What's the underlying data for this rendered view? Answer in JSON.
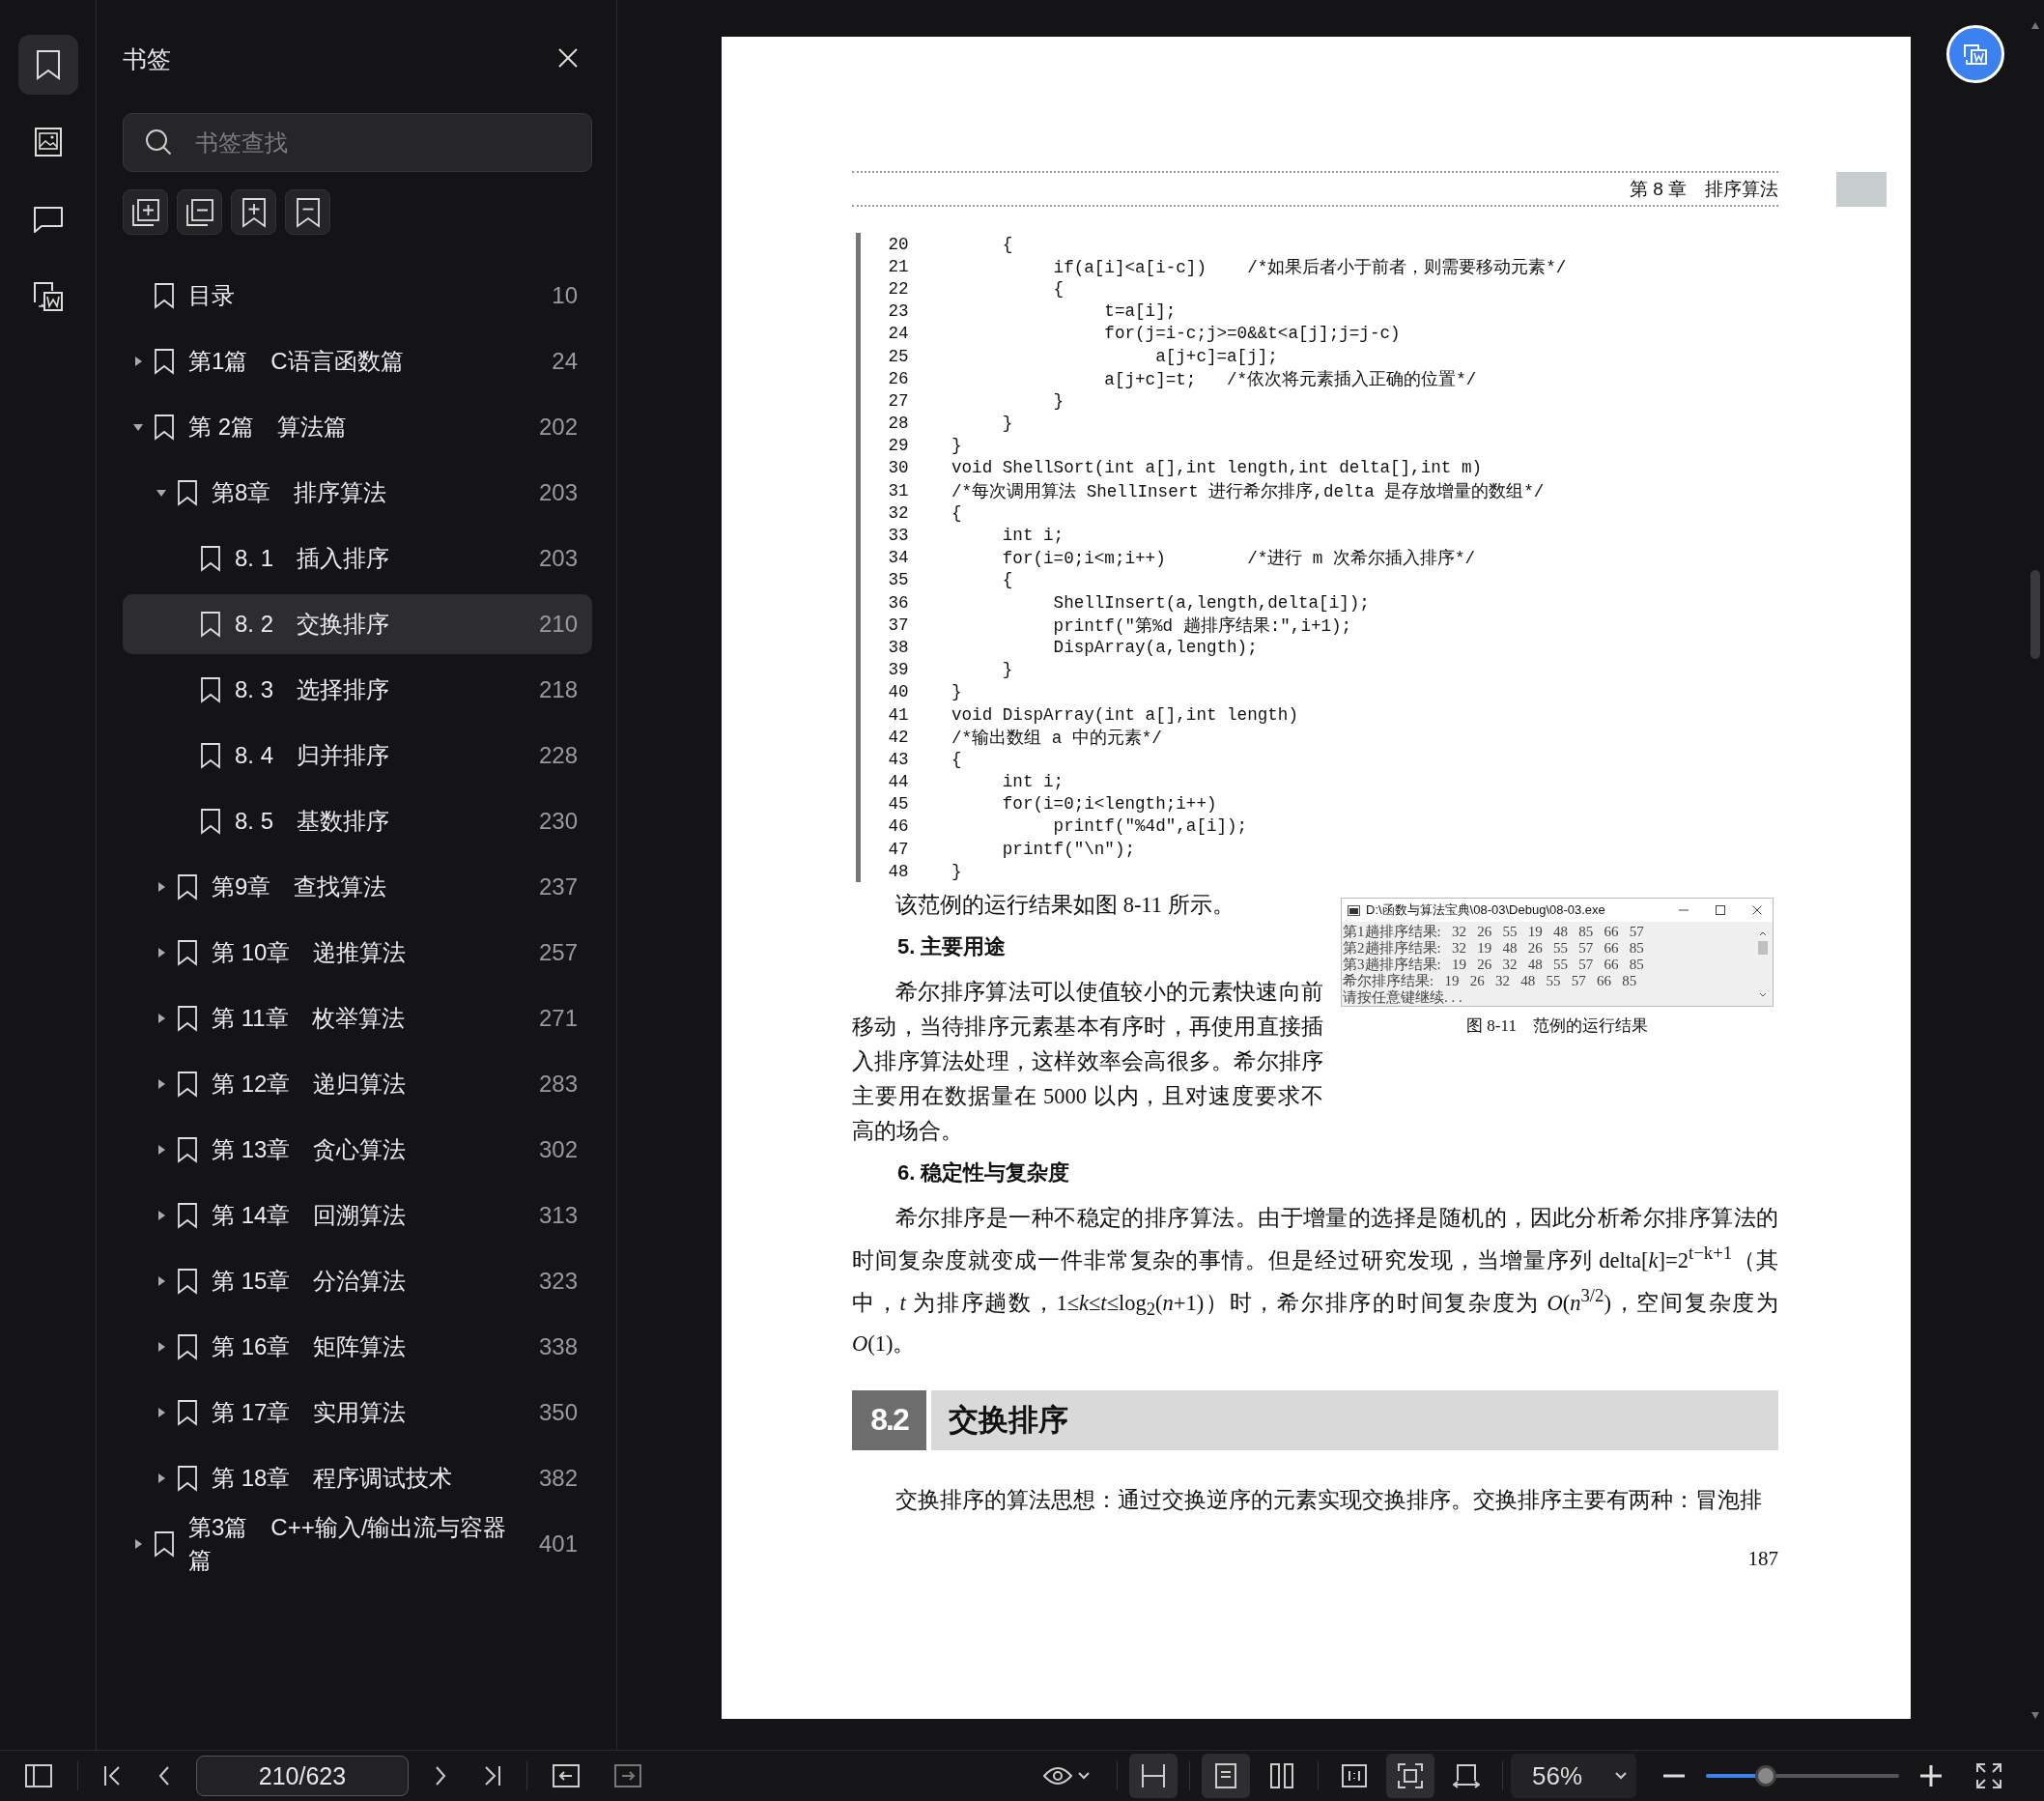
{
  "rail": [
    {
      "kind": "bookmark",
      "selected": true
    },
    {
      "kind": "image",
      "selected": false
    },
    {
      "kind": "comment",
      "selected": false
    },
    {
      "kind": "convert",
      "selected": false
    }
  ],
  "bookmarks": {
    "title": "书签",
    "search": {
      "placeholder": "书签查找"
    },
    "items": [
      {
        "label": "目录",
        "page": "10",
        "selected": false
      },
      {
        "label": "第1篇　C语言函数篇",
        "page": "24",
        "selected": false,
        "expanded": false
      },
      {
        "label": "第 2篇　算法篇",
        "page": "202",
        "selected": false,
        "expanded": true,
        "children": [
          {
            "label": "第8章　排序算法",
            "page": "203",
            "selected": false,
            "expanded": true,
            "children": [
              {
                "label": "8. 1　插入排序",
                "page": "203",
                "selected": false
              },
              {
                "label": "8. 2　交换排序",
                "page": "210",
                "selected": true
              },
              {
                "label": "8. 3　选择排序",
                "page": "218",
                "selected": false
              },
              {
                "label": "8. 4　归并排序",
                "page": "228",
                "selected": false
              },
              {
                "label": "8. 5　基数排序",
                "page": "230",
                "selected": false
              }
            ]
          },
          {
            "label": "第9章　查找算法",
            "page": "237",
            "selected": false,
            "expanded": false
          },
          {
            "label": "第 10章　递推算法",
            "page": "257",
            "selected": false,
            "expanded": false
          },
          {
            "label": "第 11章　枚举算法",
            "page": "271",
            "selected": false,
            "expanded": false
          },
          {
            "label": "第 12章　递归算法",
            "page": "283",
            "selected": false,
            "expanded": false
          },
          {
            "label": "第 13章　贪心算法",
            "page": "302",
            "selected": false,
            "expanded": false
          },
          {
            "label": "第 14章　回溯算法",
            "page": "313",
            "selected": false,
            "expanded": false
          },
          {
            "label": "第 15章　分治算法",
            "page": "323",
            "selected": false,
            "expanded": false
          },
          {
            "label": "第 16章　矩阵算法",
            "page": "338",
            "selected": false,
            "expanded": false
          },
          {
            "label": "第 17章　实用算法",
            "page": "350",
            "selected": false,
            "expanded": false
          },
          {
            "label": "第 18章　程序调试技术",
            "page": "382",
            "selected": false,
            "expanded": false
          }
        ]
      },
      {
        "label": "第3篇　C++输入/输出流与容器篇",
        "page": "401",
        "selected": false,
        "expanded": false
      }
    ]
  },
  "document": {
    "header": "第 8 章　排序算法",
    "code": [
      {
        "no": "20",
        "text": "     {"
      },
      {
        "no": "21",
        "text": "          if(a[i]<a[i-c])    /*如果后者小于前者，则需要移动元素*/"
      },
      {
        "no": "22",
        "text": "          {"
      },
      {
        "no": "23",
        "text": "               t=a[i];"
      },
      {
        "no": "24",
        "text": "               for(j=i-c;j>=0&&t<a[j];j=j-c)"
      },
      {
        "no": "25",
        "text": "                    a[j+c]=a[j];"
      },
      {
        "no": "26",
        "text": "               a[j+c]=t;   /*依次将元素插入正确的位置*/"
      },
      {
        "no": "27",
        "text": "          }"
      },
      {
        "no": "28",
        "text": "     }"
      },
      {
        "no": "29",
        "text": "}"
      },
      {
        "no": "30",
        "text": "void ShellSort(int a[],int length,int delta[],int m)"
      },
      {
        "no": "31",
        "text": "/*每次调用算法 ShellInsert 进行希尔排序,delta 是存放增量的数组*/"
      },
      {
        "no": "32",
        "text": "{"
      },
      {
        "no": "33",
        "text": "     int i;"
      },
      {
        "no": "34",
        "text": "     for(i=0;i<m;i++)        /*进行 m 次希尔插入排序*/"
      },
      {
        "no": "35",
        "text": "     {"
      },
      {
        "no": "36",
        "text": "          ShellInsert(a,length,delta[i]);"
      },
      {
        "no": "37",
        "text": "          printf(\"第%d 趟排序结果:\",i+1);"
      },
      {
        "no": "38",
        "text": "          DispArray(a,length);"
      },
      {
        "no": "39",
        "text": "     }"
      },
      {
        "no": "40",
        "text": "}"
      },
      {
        "no": "41",
        "text": "void DispArray(int a[],int length)"
      },
      {
        "no": "42",
        "text": "/*输出数组 a 中的元素*/"
      },
      {
        "no": "43",
        "text": "{"
      },
      {
        "no": "44",
        "text": "     int i;"
      },
      {
        "no": "45",
        "text": "     for(i=0;i<length;i++)"
      },
      {
        "no": "46",
        "text": "          printf(\"%4d\",a[i]);"
      },
      {
        "no": "47",
        "text": "     printf(\"\\n\");"
      },
      {
        "no": "48",
        "text": "}"
      }
    ],
    "intro": "该范例的运行结果如图 8-11 所示。",
    "figure": {
      "window_title": "D:\\函数与算法宝典\\08-03\\Debug\\08-03.exe",
      "lines": [
        "第1趟排序结果:   32   26   55   19   48   85   66   57",
        "第2趟排序结果:   32   19   48   26   55   57   66   85",
        "第3趟排序结果:   19   26   32   48   55   57   66   85",
        "希尔排序结果:   19   26   32   48   55   57   66   85",
        "请按任意键继续. . ."
      ],
      "caption": "图 8-11　范例的运行结果"
    },
    "sections": [
      {
        "heading": "5.  主要用途",
        "text": "希尔排序算法可以使值较小的元素快速向前移动，当待排序元素基本有序时，再使用直接插入排序算法处理，这样效率会高很多。希尔排序主要用在数据量在 5000 以内，且对速度要求不高的场合。"
      },
      {
        "heading": "6.  稳定性与复杂度",
        "text": "希尔排序是一种不稳定的排序算法。由于增量的选择是随机的，因此分析希尔排序算法的时间复杂度就变成一件非常复杂的事情。但是经过研究发现，当增量序列 delta[*k*]=2$^{t−k+1}$（其中，*t* 为排序趟数，1≤*k*≤*t*≤log$_{2}$(*n*+1)）时，希尔排序的时间复杂度为 *O*(*n*$^{3/2}$)，空间复杂度为 *O*(1)。"
      }
    ],
    "section_number": "8.2",
    "section_title": "交换排序",
    "closing": "交换排序的算法思想：通过交换逆序的元素实现交换排序。交换排序主要有两种：冒泡排",
    "page_number": "187"
  },
  "toolbar": {
    "page": "210/623",
    "view_modes": [
      {
        "kind": "fit-width",
        "selected": true
      },
      {
        "kind": "single",
        "selected": true
      },
      {
        "kind": "double",
        "selected": false
      },
      {
        "kind": "actual",
        "selected": false
      },
      {
        "kind": "fit-window",
        "selected": true
      },
      {
        "kind": "rotate",
        "selected": false
      }
    ],
    "zoom": "56%",
    "zoom_slider": {
      "level": 0.31
    }
  }
}
